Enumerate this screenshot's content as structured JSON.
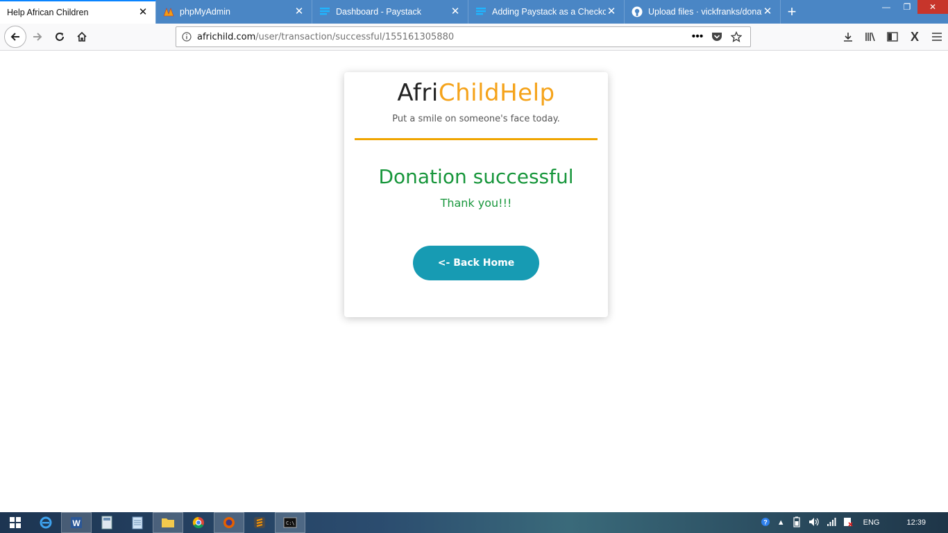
{
  "browser": {
    "tabs": [
      {
        "title": "Help African Children",
        "active": true,
        "icon": "none"
      },
      {
        "title": "phpMyAdmin",
        "active": false,
        "icon": "phpmyadmin-icon"
      },
      {
        "title": "Dashboard - Paystack",
        "active": false,
        "icon": "paystack-icon"
      },
      {
        "title": "Adding Paystack as a Checkout",
        "active": false,
        "icon": "paystack-icon"
      },
      {
        "title": "Upload files · vickfranks/donati",
        "active": false,
        "icon": "github-icon"
      }
    ],
    "url_domain": "africhild.com",
    "url_path": "/user/transaction/successful/155161305880"
  },
  "page": {
    "logo_part1": "Afri",
    "logo_part2": "ChildHelp",
    "tagline": "Put a smile on someone's face today.",
    "headline": "Donation successful",
    "subtext": "Thank you!!!",
    "button_label": "<- Back Home"
  },
  "taskbar": {
    "language": "ENG",
    "time": "12:39"
  },
  "colors": {
    "accent": "#f5a31a",
    "success": "#17963b",
    "button": "#179bb3"
  }
}
